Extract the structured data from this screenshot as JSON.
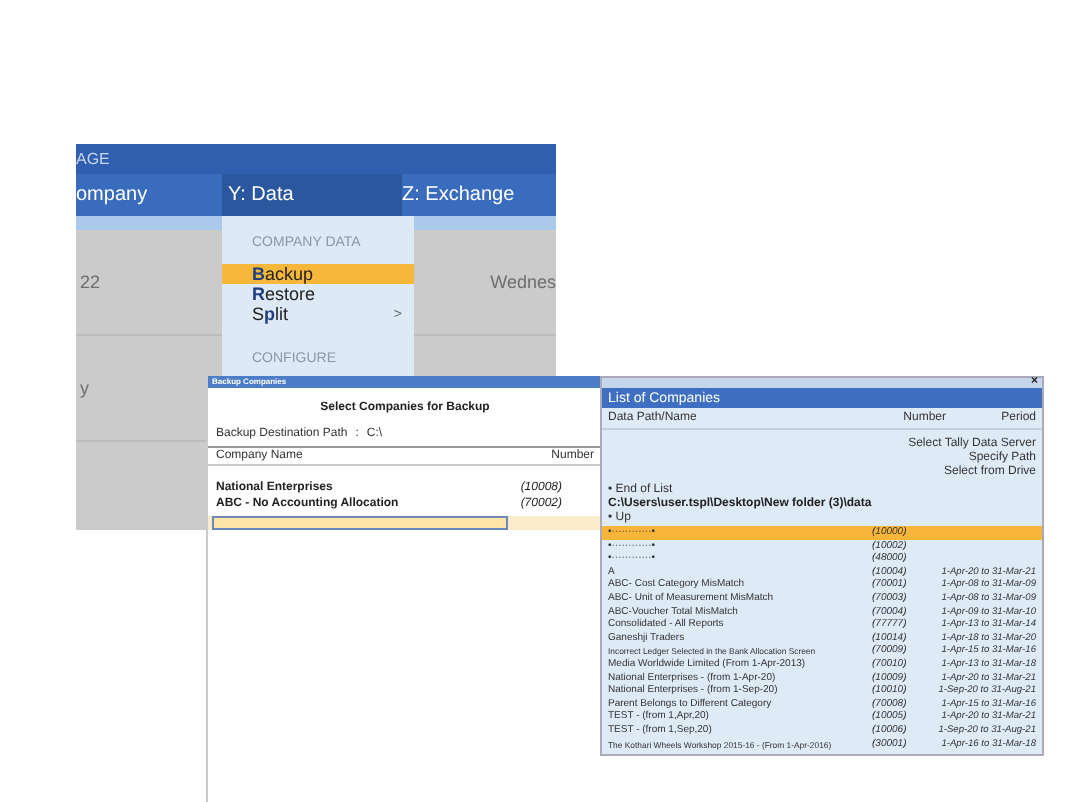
{
  "app": {
    "title": "AGE",
    "menu": [
      {
        "label": "ompany",
        "selected": false
      },
      {
        "label": "Y: Data",
        "selected": true
      },
      {
        "label": "Z: Exchange",
        "selected": false
      }
    ],
    "background_texts": [
      "22",
      "Wednes",
      "y"
    ]
  },
  "data_menu": {
    "sections": [
      {
        "heading": "COMPANY DATA",
        "items": [
          {
            "label": "**B**ackup",
            "selected": true
          },
          {
            "label": "**R**estore",
            "selected": false
          },
          {
            "label": "S**p**lit",
            "selected": false,
            "arrow": ">"
          }
        ]
      },
      {
        "heading": "CONFIGURE"
      }
    ]
  },
  "backup_dialog": {
    "title": "Backup Companies",
    "heading": "Select Companies for Backup",
    "path_label": "Backup Destination Path",
    "path_sep": ":",
    "path_value": "C:\\",
    "columns": [
      "Company Name",
      "Number"
    ],
    "rows": [
      {
        "name": "National Enterprises",
        "number": "(10008)"
      },
      {
        "name": "ABC - No Accounting Allocation",
        "number": "(70002)"
      }
    ]
  },
  "company_list": {
    "close": "×",
    "title": "List of Companies",
    "columns": [
      "Data Path/Name",
      "Number",
      "Period"
    ],
    "options": [
      "Select Tally Data Server",
      "Specify Path",
      "Select from Drive"
    ],
    "end_of_list": "• End of List",
    "path": "C:\\Users\\user.tspl\\Desktop\\New folder (3)\\data",
    "up": "• Up",
    "rows": [
      {
        "name": "•············•",
        "number": "(10000)",
        "selected": true
      },
      {
        "name": "•············•",
        "number": "(10002)",
        "selected": false
      },
      {
        "name": "•············•",
        "number": "(48000)",
        "selected": false
      },
      {
        "name": "A",
        "number": "(10004)",
        "period": "1-Apr-20 to 31-Mar-21",
        "selected": false
      },
      {
        "name": "ABC- Cost Category MisMatch",
        "number": "(70001)",
        "period": "1-Apr-08 to 31-Mar-09",
        "selected": false
      },
      {
        "name": "ABC- Unit of Measurement MisMatch",
        "number": "(70003)",
        "period": "1-Apr-08 to 31-Mar-09",
        "selected": false
      },
      {
        "name": "ABC-Voucher Total MisMatch",
        "number": "(70004)",
        "period": "1-Apr-09 to 31-Mar-10",
        "selected": false
      },
      {
        "name": "Consolidated - All Reports",
        "number": "(77777)",
        "period": "1-Apr-13 to 31-Mar-14",
        "selected": false
      },
      {
        "name": "Ganeshji Traders",
        "number": "(10014)",
        "period": "1-Apr-18 to 31-Mar-20",
        "selected": false
      },
      {
        "name": "Incorrect Ledger Selected in the Bank Allocation Screen",
        "number": "(70009)",
        "period": "1-Apr-15 to 31-Mar-16",
        "selected": false,
        "narrow": true
      },
      {
        "name": "Media Worldwide Limited  (From 1-Apr-2013)",
        "number": "(70010)",
        "period": "1-Apr-13 to 31-Mar-18",
        "selected": false
      },
      {
        "name": "National Enterprises - (from 1-Apr-20)",
        "number": "(10009)",
        "period": "1-Apr-20 to 31-Mar-21",
        "selected": false
      },
      {
        "name": "National Enterprises - (from 1-Sep-20)",
        "number": "(10010)",
        "period": "1-Sep-20 to 31-Aug-21",
        "selected": false
      },
      {
        "name": "Parent Belongs to Different Category",
        "number": "(70008)",
        "period": "1-Apr-15 to 31-Mar-16",
        "selected": false
      },
      {
        "name": "TEST - (from 1,Apr,20)",
        "number": "(10005)",
        "period": "1-Apr-20 to 31-Mar-21",
        "selected": false
      },
      {
        "name": "TEST - (from 1,Sep,20)",
        "number": "(10006)",
        "period": "1-Sep-20 to 31-Aug-21",
        "selected": false
      },
      {
        "name": "The Kothari Wheels Workshop 2015-16 - (From 1-Apr-2016)",
        "number": "(30001)",
        "period": "1-Apr-16 to 31-Mar-18",
        "selected": false,
        "narrow": true
      }
    ]
  }
}
